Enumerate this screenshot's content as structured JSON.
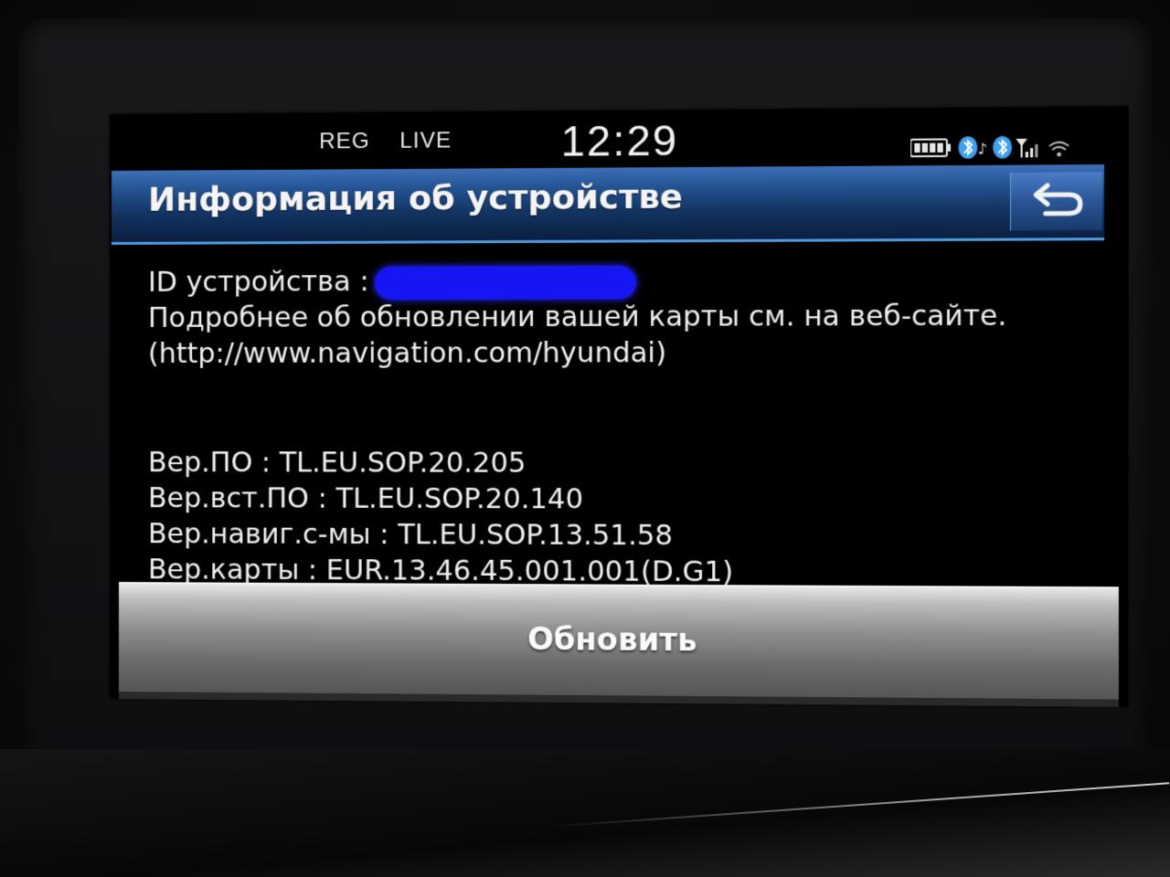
{
  "statusbar": {
    "reg_label": "REG",
    "live_label": "LIVE",
    "clock": "12:29",
    "icons": [
      "battery-icon",
      "bluetooth-audio-icon",
      "bluetooth-icon",
      "signal-icon",
      "wifi-icon"
    ]
  },
  "header": {
    "title": "Информация об устройстве",
    "back_icon": "back-arrow-icon"
  },
  "info": {
    "device_id_label": "ID устройства :",
    "update_note": "Подробнее об обновлении вашей карты см. на веб-сайте.",
    "website": "(http://www.navigation.com/hyundai)",
    "versions": [
      {
        "label": "Вер.ПО",
        "value": "TL.EU.SOP.20.205"
      },
      {
        "label": "Вер.вст.ПО",
        "value": "TL.EU.SOP.20.140"
      },
      {
        "label": "Вер.навиг.с-мы",
        "value": "TL.EU.SOP.13.51.58"
      },
      {
        "label": "Вер.карты",
        "value": "EUR.13.46.45.001.001(D.G1)"
      }
    ]
  },
  "actions": {
    "update_label": "Обновить"
  },
  "colors": {
    "title_bar": "#1b4a8a",
    "title_accent": "#4f9be0",
    "redaction": "#1616f2",
    "button_gray": "#8f8f8f"
  }
}
